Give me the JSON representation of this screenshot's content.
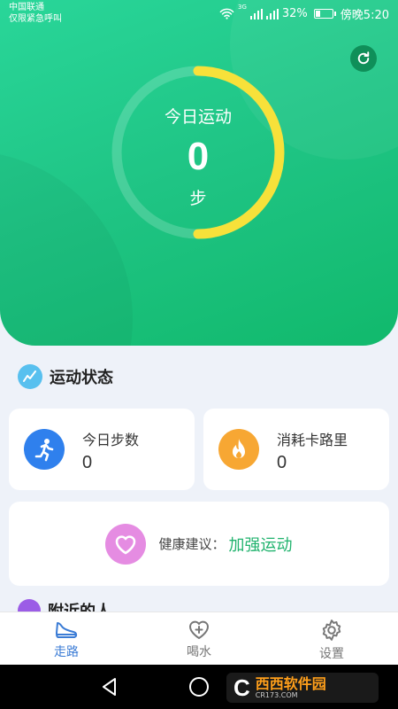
{
  "status_bar": {
    "carrier_line1": "中国联通",
    "carrier_line2": "仅限紧急呼叫",
    "network": "3G",
    "battery_percent": "32%",
    "battery_level": 0.32,
    "time": "傍晚5:20"
  },
  "hero": {
    "title": "今日运动",
    "steps": "0",
    "unit": "步",
    "refresh_icon": "refresh-icon",
    "ring_progress": 0.5
  },
  "status_section": {
    "title": "运动状态",
    "cards": [
      {
        "label": "今日步数",
        "value": "0",
        "icon": "running-icon",
        "color": "#2f80ed"
      },
      {
        "label": "消耗卡路里",
        "value": "0",
        "icon": "flame-icon",
        "color": "#f7a733"
      }
    ]
  },
  "health": {
    "label": "健康建议：",
    "value": "加强运动",
    "icon": "heart-icon"
  },
  "nearby": {
    "title": "附近的人"
  },
  "tabs": [
    {
      "label": "走路",
      "icon": "shoe-icon",
      "active": true
    },
    {
      "label": "喝水",
      "icon": "heart-plus-icon",
      "active": false
    },
    {
      "label": "设置",
      "icon": "gear-icon",
      "active": false
    }
  ],
  "watermark": {
    "brand": "西西软件园",
    "url": "CR173.COM"
  },
  "colors": {
    "accent_green": "#1fc484",
    "ring_yellow": "#f7e13a",
    "tab_active": "#3a7bd5"
  }
}
